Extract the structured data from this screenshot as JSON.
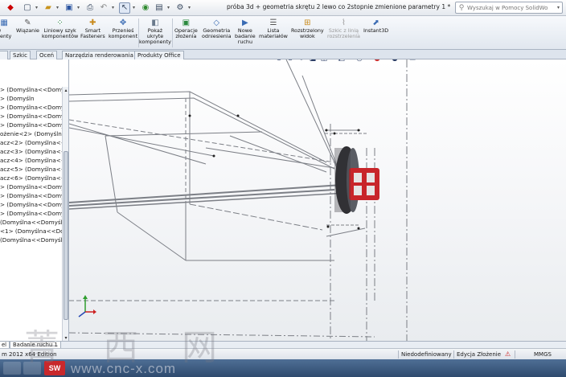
{
  "window": {
    "title": "próba 3d + geometria skrętu 2 lewo co 2stopnie zmienione parametry 1 *"
  },
  "search": {
    "placeholder": "Wyszukaj w Pomocy SolidWorks"
  },
  "ribbon": {
    "tools": [
      {
        "label": "w\nnenty",
        "icon": "insert-component-icon"
      },
      {
        "label": "Wiązanie",
        "icon": "mate-icon"
      },
      {
        "label": "Liniowy szyk\nkomponentów",
        "icon": "linear-pattern-icon"
      },
      {
        "label": "Smart\nFasteners",
        "icon": "smart-fasteners-icon"
      },
      {
        "label": "Przenieś\nkomponent",
        "icon": "move-component-icon"
      },
      {
        "label": "Pokaż\nukryte\nkomponenty",
        "icon": "show-hidden-icon"
      },
      {
        "label": "Operacje\nzłożenia",
        "icon": "assembly-features-icon"
      },
      {
        "label": "Geometria\nodniesienia",
        "icon": "reference-geometry-icon"
      },
      {
        "label": "Nowe\nbadanie\nruchu",
        "icon": "motion-study-icon"
      },
      {
        "label": "Lista\nmateriałów",
        "icon": "bom-icon"
      },
      {
        "label": "Rozstrzelony\nwidok",
        "icon": "exploded-view-icon"
      },
      {
        "label": "Szkic z linią\nrozstrzelenia",
        "icon": "explode-line-sketch-icon"
      },
      {
        "label": "Instant3D",
        "icon": "instant3d-icon"
      }
    ]
  },
  "tabs": [
    "Szkic",
    "Oceń",
    "Narzędzia renderowania",
    "Produkty Office"
  ],
  "tree": {
    "items": [
      "> (Domyślna<<Domyśl",
      "> (Domyśln",
      "> (Domyślna<<Domyśln",
      "> (Domyślna<<Domyśl",
      "> (Domyślna<<Domyśln",
      "ożenie<2> (Domyślna<<S",
      "acz<2> (Domyślna<<Do",
      "acz<3> (Domyślna<<Do",
      "acz<4> (Domyślna<<Do",
      "acz<5> (Domyślna<<Do",
      "acz<6> (Domyślna<<Do",
      "> (Domyślna<<Domyśl",
      "> (Domyślna<<Domyśln",
      "> (Domyślna<<Domyśln",
      "> (Domyślna<<Domyśl",
      " (Domyślna<<Domyśln",
      "<1> (Domyślna<<Domyś",
      " (Domyślna<<Domyśln"
    ]
  },
  "bottom_tabs": [
    "el",
    "Badanie ruchu 1"
  ],
  "status": {
    "edition": "m 2012 x64 Edition",
    "definition": "Niedodefiniowany",
    "mode": "Edycja Złożenie",
    "units": "MMGS"
  },
  "watermark": {
    "chinese": "菁 西 网",
    "url": "www.cnc-x.com"
  },
  "colors": {
    "brake_caliper": "#c8252a",
    "ribbon_bg": "#e8edf3",
    "viewport_bg": "#f4f5f7"
  }
}
